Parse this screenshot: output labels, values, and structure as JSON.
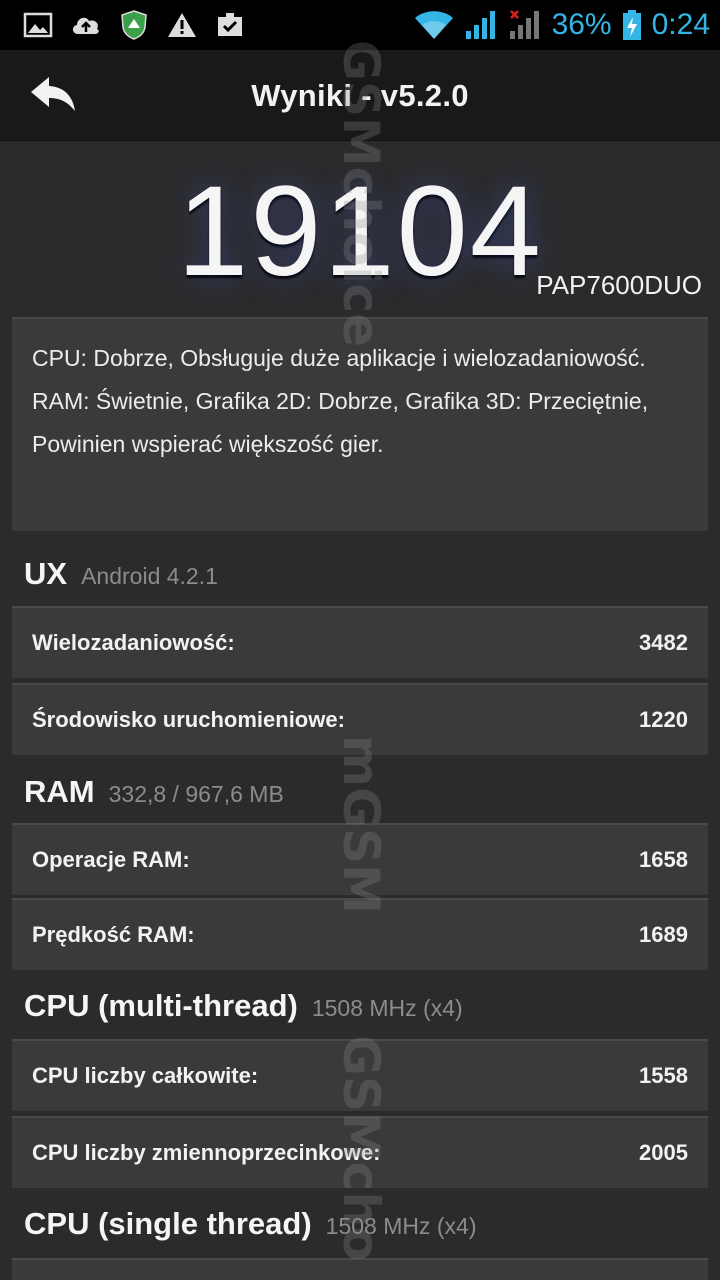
{
  "status_bar": {
    "battery": "36%",
    "time": "0:24",
    "icons": [
      "image-icon",
      "cloud-upload-icon",
      "shield-icon",
      "warning-icon",
      "clipboard-check-icon",
      "wifi-icon",
      "signal-icon",
      "signal-no-service-icon",
      "battery-charging-icon"
    ],
    "accent_color": "#33b5e5"
  },
  "action_bar": {
    "title": "Wyniki - v5.2.0",
    "back_icon": "back-arrow-icon"
  },
  "result": {
    "score": "19104",
    "device": "PAP7600DUO",
    "description": "CPU: Dobrze, Obsługuje duże aplikacje i wielozadaniowość. RAM: Świetnie, Grafika 2D: Dobrze, Grafika 3D: Przeciętnie, Powinien wspierać większość gier."
  },
  "sections": [
    {
      "title": "UX",
      "subtitle": "Android 4.2.1",
      "rows": [
        {
          "label": "Wielozadaniowość:",
          "value": "3482"
        },
        {
          "label": "Środowisko uruchomieniowe:",
          "value": "1220"
        }
      ]
    },
    {
      "title": "RAM",
      "subtitle": "332,8 / 967,6 MB",
      "rows": [
        {
          "label": "Operacje RAM:",
          "value": "1658"
        },
        {
          "label": "Prędkość RAM:",
          "value": "1689"
        }
      ]
    },
    {
      "title": "CPU (multi-thread)",
      "subtitle": "1508 MHz (x4)",
      "rows": [
        {
          "label": "CPU liczby całkowite:",
          "value": "1558"
        },
        {
          "label": "CPU liczby zmiennoprzecinkowe:",
          "value": "2005"
        }
      ]
    },
    {
      "title": "CPU (single thread)",
      "subtitle": "1508 MHz (x4)",
      "rows": []
    }
  ],
  "watermark": {
    "text_1": "GSMchoice",
    "text_2": "mGSM",
    "text_3": "GSMcho"
  }
}
